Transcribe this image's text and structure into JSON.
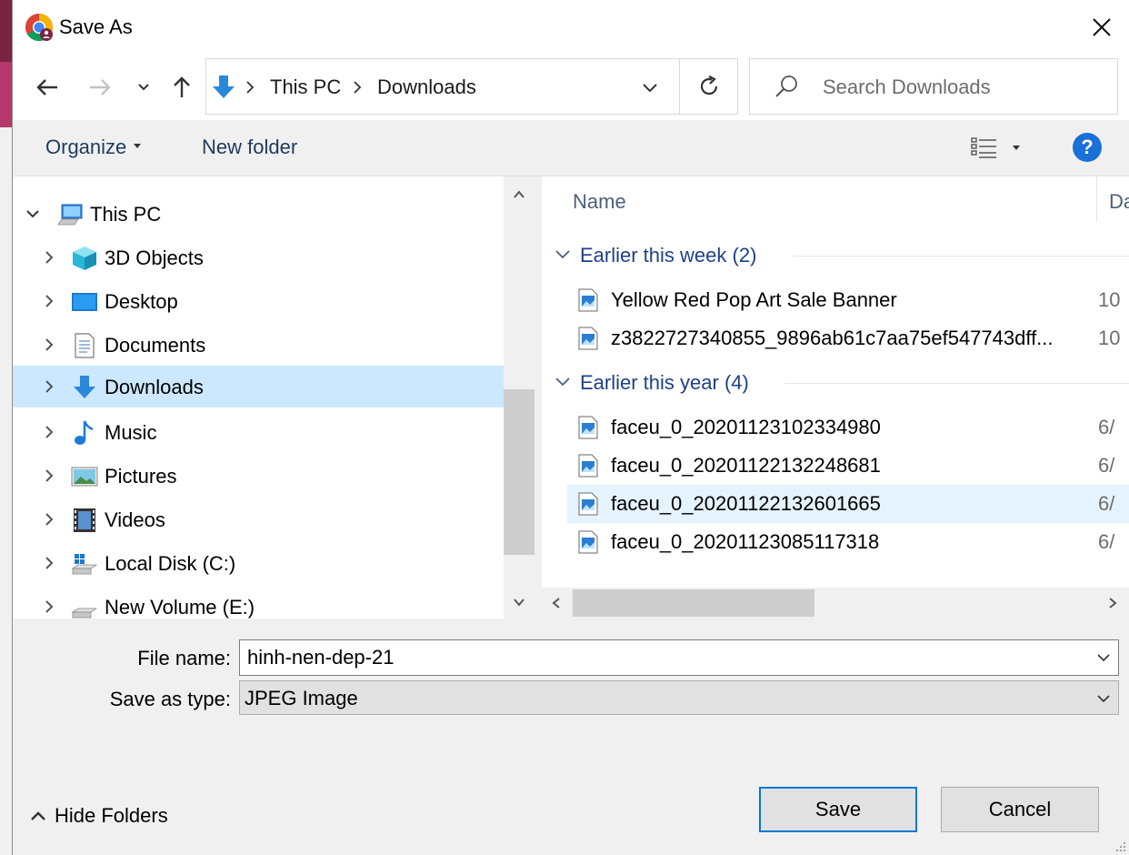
{
  "window": {
    "title": "Save As"
  },
  "address": {
    "crumbs": [
      "This PC",
      "Downloads"
    ]
  },
  "search": {
    "placeholder": "Search Downloads"
  },
  "toolbar": {
    "organize_label": "Organize",
    "new_folder_label": "New folder",
    "help_label": "?"
  },
  "nav_tree": {
    "root": "This PC",
    "items": [
      {
        "label": "3D Objects",
        "icon": "3d-objects-icon"
      },
      {
        "label": "Desktop",
        "icon": "desktop-icon"
      },
      {
        "label": "Documents",
        "icon": "documents-icon"
      },
      {
        "label": "Downloads",
        "icon": "downloads-icon",
        "selected": true
      },
      {
        "label": "Music",
        "icon": "music-icon"
      },
      {
        "label": "Pictures",
        "icon": "pictures-icon"
      },
      {
        "label": "Videos",
        "icon": "videos-icon"
      },
      {
        "label": "Local Disk (C:)",
        "icon": "local-disk-icon"
      },
      {
        "label": "New Volume (E:)",
        "icon": "drive-icon"
      }
    ]
  },
  "file_list": {
    "columns": {
      "name": "Name",
      "date": "Da"
    },
    "groups": [
      {
        "label": "Earlier this week (2)",
        "files": [
          {
            "name": "Yellow Red Pop Art Sale Banner",
            "date": "10"
          },
          {
            "name": "z3822727340855_9896ab61c7aa75ef547743dff...",
            "date": "10"
          }
        ]
      },
      {
        "label": "Earlier this year (4)",
        "files": [
          {
            "name": "faceu_0_20201123102334980",
            "date": "6/"
          },
          {
            "name": "faceu_0_20201122132248681",
            "date": "6/"
          },
          {
            "name": "faceu_0_20201122132601665",
            "date": "6/",
            "hover": true
          },
          {
            "name": "faceu_0_20201123085117318",
            "date": "6/"
          }
        ]
      }
    ]
  },
  "form": {
    "file_name_label": "File name:",
    "file_name_value": "hinh-nen-dep-21",
    "save_type_label": "Save as type:",
    "save_type_value": "JPEG Image"
  },
  "footer": {
    "hide_folders_label": "Hide Folders",
    "save_label": "Save",
    "cancel_label": "Cancel"
  },
  "colors": {
    "accent": "#0078d7",
    "selection": "#cce8ff",
    "hover": "#e5f3ff",
    "group_text": "#1e3f8a"
  }
}
